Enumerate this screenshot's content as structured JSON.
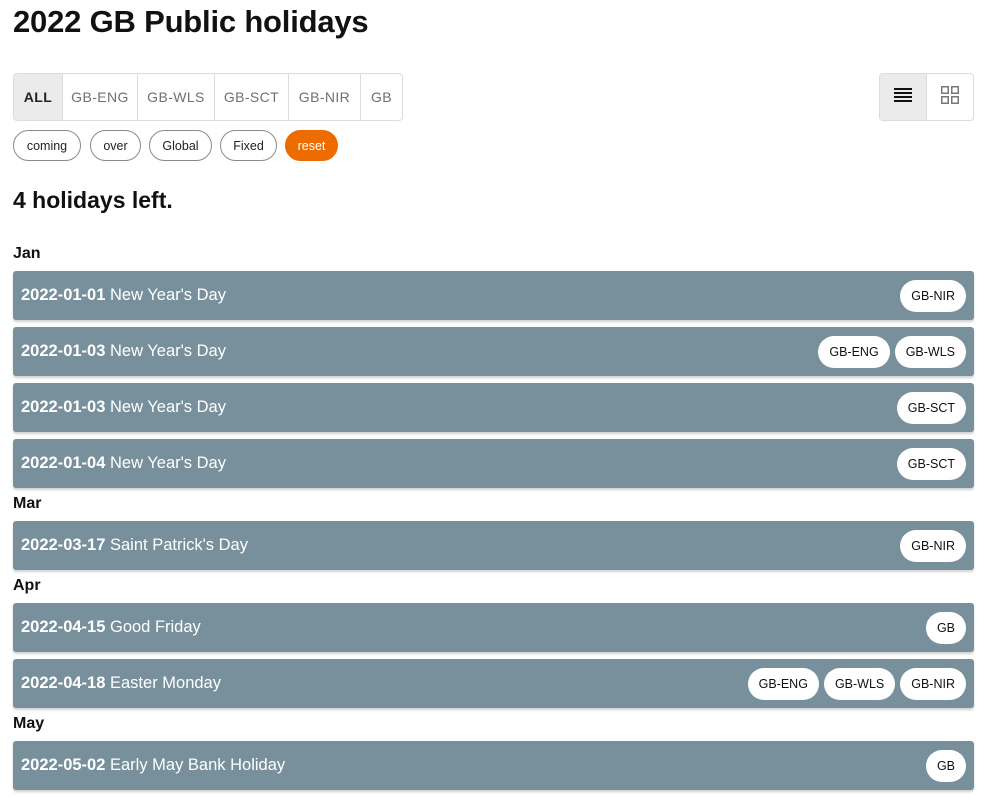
{
  "page_title": "2022 GB Public holidays",
  "region_tabs": [
    "ALL",
    "GB-ENG",
    "GB-WLS",
    "GB-SCT",
    "GB-NIR",
    "GB"
  ],
  "filters": {
    "coming": "coming",
    "over": "over",
    "global": "Global",
    "fixed": "Fixed",
    "reset": "reset"
  },
  "summary": "4 holidays left.",
  "months": [
    "Jan",
    "Mar",
    "Apr",
    "May"
  ],
  "holidays": [
    {
      "date": "2022-01-01",
      "name": "New Year's Day",
      "regions": [
        "GB-NIR"
      ]
    },
    {
      "date": "2022-01-03",
      "name": "New Year's Day",
      "regions": [
        "GB-ENG",
        "GB-WLS"
      ]
    },
    {
      "date": "2022-01-03",
      "name": "New Year's Day",
      "regions": [
        "GB-SCT"
      ]
    },
    {
      "date": "2022-01-04",
      "name": "New Year's Day",
      "regions": [
        "GB-SCT"
      ]
    },
    {
      "date": "2022-03-17",
      "name": "Saint Patrick's Day",
      "regions": [
        "GB-NIR"
      ]
    },
    {
      "date": "2022-04-15",
      "name": "Good Friday",
      "regions": [
        "GB"
      ]
    },
    {
      "date": "2022-04-18",
      "name": "Easter Monday",
      "regions": [
        "GB-ENG",
        "GB-WLS",
        "GB-NIR"
      ]
    },
    {
      "date": "2022-05-02",
      "name": "Early May Bank Holiday",
      "regions": [
        "GB"
      ]
    }
  ],
  "icons": {
    "list_view": "list-view-icon",
    "grid_view": "grid-view-icon"
  },
  "colors": {
    "row_bg": "#78909c",
    "reset_chip": "#ed6c02",
    "active_tab_bg": "#ebebeb"
  }
}
